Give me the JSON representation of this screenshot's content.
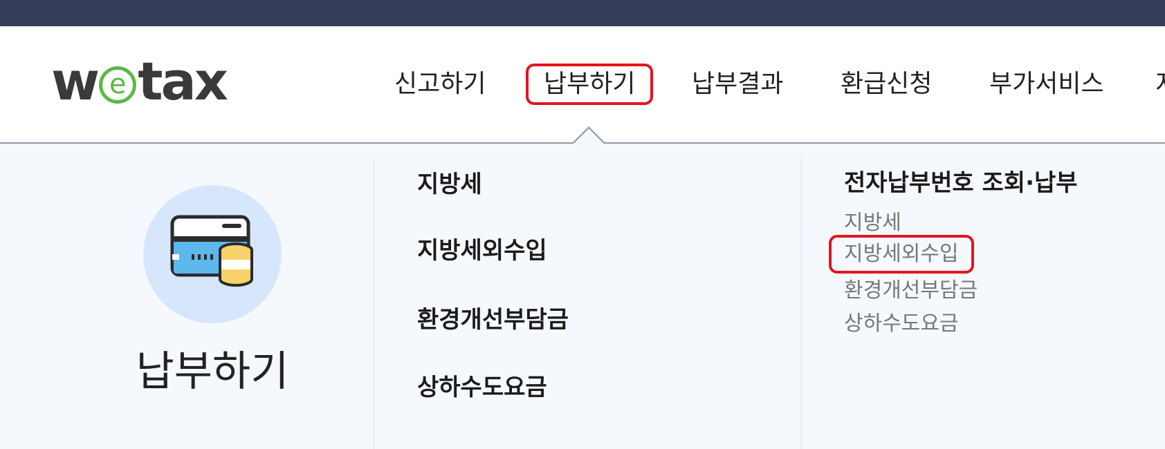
{
  "logo": {
    "part1": "w",
    "e": "e",
    "part2": "tax"
  },
  "gnb": {
    "items": [
      {
        "label": "신고하기"
      },
      {
        "label": "납부하기"
      },
      {
        "label": "납부결과"
      },
      {
        "label": "환급신청"
      },
      {
        "label": "부가서비스"
      },
      {
        "label": "지"
      }
    ],
    "active_index": 1
  },
  "panel": {
    "title": "납부하기",
    "icon": "payment-card-coins-icon",
    "menu": [
      {
        "label": "지방세"
      },
      {
        "label": "지방세외수입"
      },
      {
        "label": "환경개선부담금"
      },
      {
        "label": "상하수도요금"
      }
    ],
    "sub": {
      "title": "전자납부번호 조회·납부",
      "items": [
        {
          "label": "지방세"
        },
        {
          "label": "지방세외수입"
        },
        {
          "label": "환경개선부담금"
        },
        {
          "label": "상하수도요금"
        }
      ],
      "active_index": 1
    }
  },
  "colors": {
    "topbar": "#363d58",
    "highlight": "#e3141e",
    "logo_green": "#5cb946",
    "panel_bg": "#f5f9fd",
    "icon_circle": "#d6e7fb"
  }
}
